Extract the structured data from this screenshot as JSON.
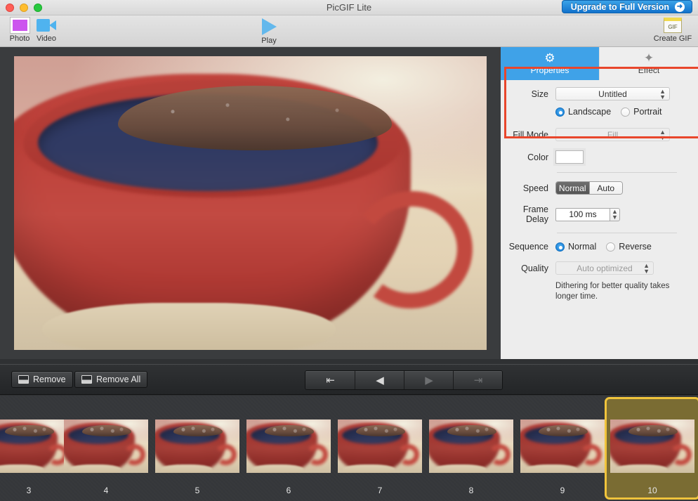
{
  "window": {
    "title": "PicGIF Lite",
    "traffic_lights": [
      "close",
      "minimize",
      "zoom"
    ],
    "upgrade_button": "Upgrade to Full Version",
    "upgrade_arrow_glyph": "➜"
  },
  "toolbar": {
    "items": [
      {
        "label": "Photo",
        "icon": "photo-icon"
      },
      {
        "label": "Video",
        "icon": "video-icon"
      },
      {
        "label": "Play",
        "icon": "play-icon"
      },
      {
        "label": "Create GIF",
        "icon": "gif-icon",
        "badge": "GIF"
      }
    ]
  },
  "panel": {
    "tabs": [
      {
        "label": "Properties",
        "icon": "gear-icon",
        "glyph": "⚙",
        "active": true
      },
      {
        "label": "Effect",
        "icon": "magic-wand-icon",
        "glyph": "✦",
        "active": false
      }
    ],
    "size": {
      "label": "Size",
      "value": "Untitled",
      "orientation_options": [
        "Landscape",
        "Portrait"
      ],
      "orientation_selected": "Landscape"
    },
    "fill_mode": {
      "label": "Fill Mode",
      "value": "Fill",
      "disabled": true
    },
    "color": {
      "label": "Color",
      "value": "#ffffff"
    },
    "speed": {
      "label": "Speed",
      "options": [
        "Normal",
        "Auto"
      ],
      "selected": "Normal"
    },
    "frame_delay": {
      "label": "Frame Delay",
      "value": "100 ms"
    },
    "sequence": {
      "label": "Sequence",
      "options": [
        "Normal",
        "Reverse"
      ],
      "selected": "Normal"
    },
    "quality": {
      "label": "Quality",
      "value": "Auto optimized",
      "hint": "Dithering for better quality takes longer time."
    },
    "highlight_color": "#e8462c"
  },
  "controls": {
    "remove": "Remove",
    "remove_all": "Remove All",
    "nav": [
      {
        "name": "first-frame",
        "glyph": "⇤",
        "enabled": true
      },
      {
        "name": "previous-frame",
        "glyph": "◀",
        "enabled": true
      },
      {
        "name": "next-frame",
        "glyph": "▶",
        "enabled": false
      },
      {
        "name": "last-frame",
        "glyph": "⇥",
        "enabled": false
      }
    ]
  },
  "filmstrip": {
    "frames": [
      {
        "number": "3",
        "selected": false
      },
      {
        "number": "4",
        "selected": false
      },
      {
        "number": "5",
        "selected": false
      },
      {
        "number": "6",
        "selected": false
      },
      {
        "number": "7",
        "selected": false
      },
      {
        "number": "8",
        "selected": false
      },
      {
        "number": "9",
        "selected": false
      },
      {
        "number": "10",
        "selected": true
      }
    ],
    "selected_color": "#f0c43c"
  }
}
